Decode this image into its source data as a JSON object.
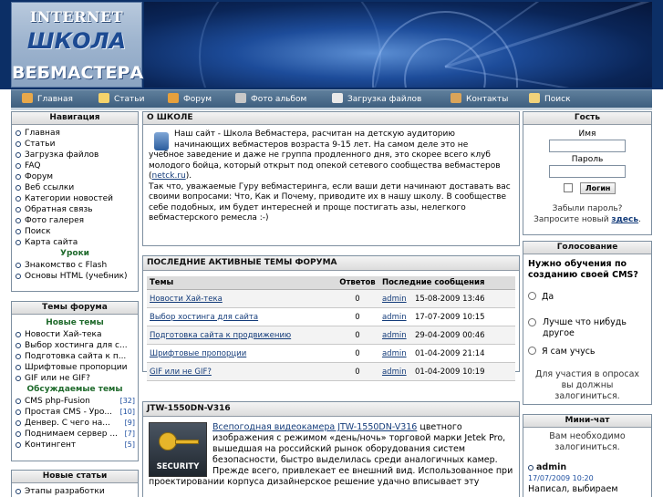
{
  "logo": {
    "line1": "INTERNET",
    "line2": "ШКОЛА",
    "line3": "ВЕБМАСТЕРА"
  },
  "nav": [
    {
      "label": "Главная",
      "icon": "home-icon",
      "color": "#e8a84a"
    },
    {
      "label": "Статьи",
      "icon": "pencil-icon",
      "color": "#f5d36b"
    },
    {
      "label": "Форум",
      "icon": "people-icon",
      "color": "#e6a03c"
    },
    {
      "label": "Фото альбом",
      "icon": "camera-icon",
      "color": "#c8c8c8"
    },
    {
      "label": "Загрузка файлов",
      "icon": "floppy-icon",
      "color": "#e9e9e9"
    },
    {
      "label": "Контакты",
      "icon": "contacts-icon",
      "color": "#d9a45a"
    },
    {
      "label": "Поиск",
      "icon": "search-icon",
      "color": "#f1d27a"
    }
  ],
  "left": {
    "navigation": {
      "title": "Навигация",
      "items": [
        "Главная",
        "Статьи",
        "Загрузка файлов",
        "FAQ",
        "Форум",
        "Веб ссылки",
        "Категории новостей",
        "Обратная связь",
        "Фото галерея",
        "Поиск",
        "Карта сайта"
      ],
      "lessons_title": "Уроки",
      "lessons": [
        "Знакомство с Flash",
        "Основы HTML (учебник)"
      ]
    },
    "forum": {
      "title": "Темы форума",
      "new_title": "Новые темы",
      "new_items": [
        "Новости Хай-тека",
        "Выбор хостинга для с...",
        "Подготовка сайта к п...",
        "Шрифтовые пропорции",
        "GIF или не GIF?"
      ],
      "discussed_title": "Обсуждаемые темы",
      "discussed": [
        {
          "label": "CMS php-Fusion",
          "count": "[32]"
        },
        {
          "label": "Простая CMS - Уро...",
          "count": "[10]"
        },
        {
          "label": "Денвер. С чего на...",
          "count": "[9]"
        },
        {
          "label": "Поднимаем сервер ...",
          "count": "[7]"
        },
        {
          "label": "Контингент",
          "count": "[5]"
        }
      ]
    },
    "articles": {
      "title": "Новые статьи",
      "items": [
        "Этапы разработки"
      ]
    }
  },
  "center": {
    "about": {
      "title": "О ШКОЛЕ",
      "icon": "globe-icon",
      "p1_lead": "Наш сайт - Школа Вебмастера, расчитан на детскую аудиторию",
      "p1_line2": "начинающих вебмастеров возраста 9-15 лет. На самом деле это не",
      "p1_rest": "учебное заведение и даже не группа продленного дня, это скорее всего клуб молодого бойца, который открыт под опекой сетевого сообщества вебмастеров (",
      "p1_link": "netck.ru",
      "p1_end": ").",
      "p2": "Так что, уважаемые Гуру вебмастеринга, если ваши дети начинают доставать вас своими вопросами: Что, Как и Почему, приводите их в нашу школу. В сообществе себе подобных, им будет интересней и проще постигать азы, нелегкого вебмастерского ремесла :-)"
    },
    "forum_topics": {
      "title": "ПОСЛЕДНИЕ АКТИВНЫЕ ТЕМЫ ФОРУМА",
      "headers": [
        "Темы",
        "Ответов",
        "Последние сообщения"
      ],
      "rows": [
        {
          "topic": "Новости Хай-тека",
          "replies": "0",
          "user": "admin",
          "date": "15-08-2009 13:46"
        },
        {
          "topic": "Выбор хостинга для сайта",
          "replies": "0",
          "user": "admin",
          "date": "17-07-2009 10:15"
        },
        {
          "topic": "Подготовка сайта к продвижению",
          "replies": "0",
          "user": "admin",
          "date": "29-04-2009 00:46"
        },
        {
          "topic": "Шрифтовые пропорции",
          "replies": "0",
          "user": "admin",
          "date": "01-04-2009 21:14"
        },
        {
          "topic": "GIF или не GIF?",
          "replies": "0",
          "user": "admin",
          "date": "01-04-2009 10:19"
        }
      ]
    },
    "article": {
      "title": "JTW-1550DN-V316",
      "image_label": "SECURITY",
      "link": "Всепогодная видеокамера JTW-1550DN-V316",
      "text1": " цветного изображения с режимом «день/ночь» торговой марки Jetek Pro, вышедшая на российский рынок оборудования систем безопасности, быстро выделилась среди аналогичных камер. Прежде всего, привлекает ее внешний вид. Использованное при проектировании корпуса дизайнерское решение удачно вписывает эту"
    }
  },
  "right": {
    "login": {
      "title": "Гость",
      "name_label": "Имя",
      "password_label": "Пароль",
      "button": "Логин",
      "forgot": "Забыли пароль?",
      "register_prefix": "Запросите новый",
      "register_link": "здесь",
      "register_suffix": "."
    },
    "poll": {
      "title": "Голосование",
      "question": "Нужно обучения по созданию своей CMS?",
      "options": [
        "Да",
        "Лучше что нибудь другое",
        "Я сам учусь"
      ],
      "note": "Для участия в опросах вы должны залогиниться."
    },
    "chat": {
      "title": "Мини-чат",
      "note": "Вам необходимо залогиниться.",
      "user": "admin",
      "date": "17/07/2009 10:20",
      "message": "Написал, выбираем"
    }
  }
}
